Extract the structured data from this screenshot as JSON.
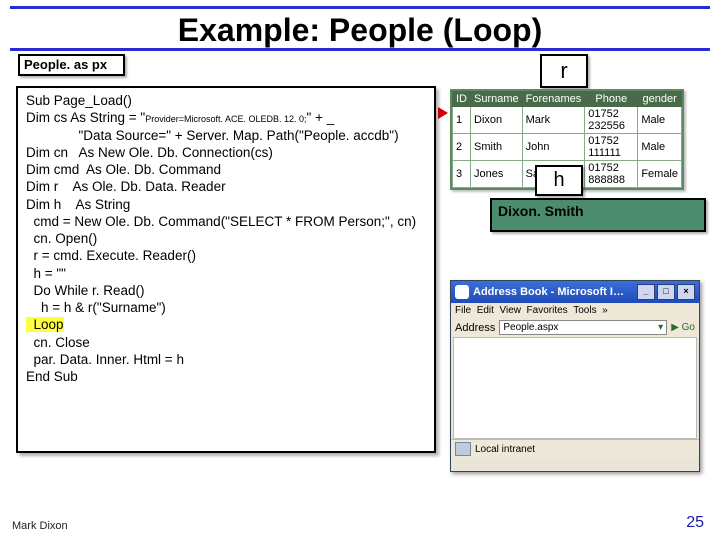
{
  "title": "Example: People (Loop)",
  "filelabel": "People. as px",
  "r_label": "r",
  "h_label": "h",
  "h_value": "Dixon. Smith",
  "code": {
    "l1": "Sub Page_Load()",
    "l2a": "Dim cs As String = \"",
    "l2b": "Provider=Microsoft. ACE. OLEDB. 12. 0;",
    "l2c": "\" + _",
    "l3": "              \"Data Source=\" + Server. Map. Path(\"People. accdb\")",
    "l4": "Dim cn   As New Ole. Db. Connection(cs)",
    "l5": "Dim cmd  As Ole. Db. Command",
    "l6": "Dim r    As Ole. Db. Data. Reader",
    "l7": "Dim h    As String",
    "l8": "  cmd = New Ole. Db. Command(\"SELECT * FROM Person;\", cn)",
    "l9": "  cn. Open()",
    "l10": "  r = cmd. Execute. Reader()",
    "l11": "  h = \"\"",
    "l12": "  Do While r. Read()",
    "l13": "    h = h & r(\"Surname\")",
    "l14": "  Loop",
    "l15": "  cn. Close",
    "l16": "  par. Data. Inner. Html = h",
    "l17": "End Sub"
  },
  "table": {
    "headers": [
      "ID",
      "Surname",
      "Forenames",
      "Phone",
      "gender"
    ],
    "rows": [
      [
        "1",
        "Dixon",
        "Mark",
        "01752 232556",
        "Male"
      ],
      [
        "2",
        "Smith",
        "John",
        "01752 111111",
        "Male"
      ],
      [
        "3",
        "Jones",
        "Sally",
        "01752 888888",
        "Female"
      ]
    ]
  },
  "browser": {
    "title": "Address Book - Microsoft I…",
    "menu": {
      "file": "File",
      "edit": "Edit",
      "view": "View",
      "fav": "Favorites",
      "tools": "Tools"
    },
    "address_label": "Address",
    "address_value": "People.aspx",
    "go": "Go",
    "status": "Local intranet"
  },
  "footer": {
    "name": "Mark Dixon",
    "page": "25"
  }
}
